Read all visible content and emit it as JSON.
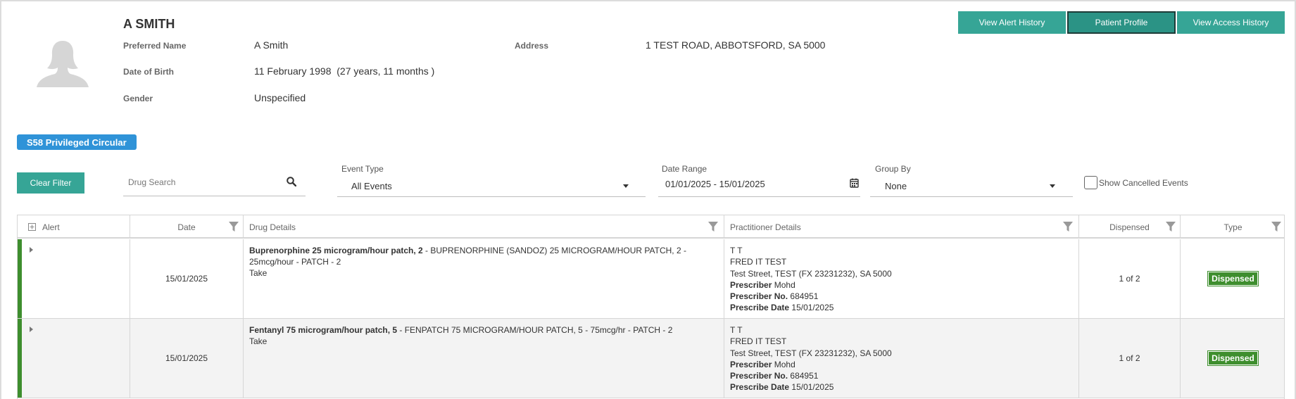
{
  "patient": {
    "name": "A SMITH",
    "fields": {
      "preferred_name_label": "Preferred Name",
      "preferred_name": "A Smith",
      "dob_label": "Date of Birth",
      "dob": "11 February 1998  (27 years, 11 months )",
      "gender_label": "Gender",
      "gender": "Unspecified",
      "address_label": "Address",
      "address": "1 TEST ROAD, ABBOTSFORD, SA 5000"
    },
    "avatar_icon": "person-silhouette-icon"
  },
  "header_buttons": {
    "alert_history": "View Alert History",
    "patient_profile": "Patient Profile",
    "access_history": "View Access History"
  },
  "badge": "S58 Privileged Circular",
  "filters": {
    "clear_label": "Clear Filter",
    "drug_search_placeholder": "Drug Search",
    "event_type_label": "Event Type",
    "event_type_value": "All Events",
    "date_range_label": "Date Range",
    "date_range_value": "01/01/2025 - 15/01/2025",
    "group_by_label": "Group By",
    "group_by_value": "None",
    "show_cancelled_label": "Show Cancelled Events",
    "show_cancelled_checked": false
  },
  "table": {
    "columns": {
      "alert": "Alert",
      "date": "Date",
      "drug": "Drug Details",
      "practitioner": "Practitioner Details",
      "dispensed": "Dispensed",
      "type": "Type"
    },
    "rows": [
      {
        "date": "15/01/2025",
        "drug_bold": "Buprenorphine 25 microgram/hour patch, 2",
        "drug_rest": " - BUPRENORPHINE (SANDOZ) 25 MICROGRAM/HOUR PATCH, 2 - 25mcg/hour - PATCH - 2",
        "drug_instruction": "Take",
        "prac_name": "T T",
        "prac_org": "FRED IT TEST",
        "prac_address": "Test Street, TEST (FX 23231232), SA 5000",
        "prescriber_label": "Prescriber",
        "prescriber": "Mohd",
        "prescriber_no_label": "Prescriber No.",
        "prescriber_no": "684951",
        "prescribe_date_label": "Prescribe Date",
        "prescribe_date": "15/01/2025",
        "dispensed": "1 of 2",
        "type": "Dispensed"
      },
      {
        "date": "15/01/2025",
        "drug_bold": "Fentanyl 75 microgram/hour patch, 5",
        "drug_rest": " - FENPATCH 75 MICROGRAM/HOUR PATCH, 5 - 75mcg/hr - PATCH - 2",
        "drug_instruction": "Take",
        "prac_name": "T T",
        "prac_org": "FRED IT TEST",
        "prac_address": "Test Street, TEST (FX 23231232), SA 5000",
        "prescriber_label": "Prescriber",
        "prescriber": "Mohd",
        "prescriber_no_label": "Prescriber No.",
        "prescriber_no": "684951",
        "prescribe_date_label": "Prescribe Date",
        "prescribe_date": "15/01/2025",
        "dispensed": "1 of 2",
        "type": "Dispensed"
      }
    ]
  },
  "colors": {
    "teal": "#36a596",
    "badge_blue": "#2f93d8",
    "status_green": "#3e8e2e"
  }
}
